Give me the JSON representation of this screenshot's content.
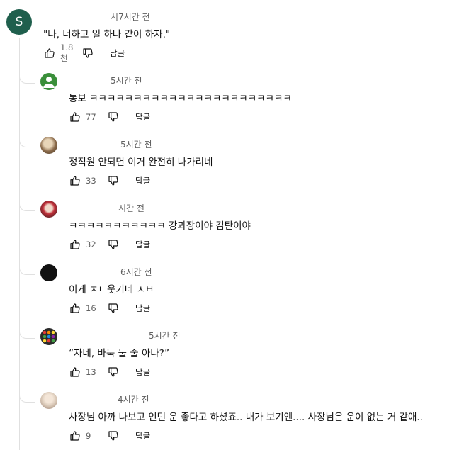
{
  "top_comment": {
    "avatar_letter": "S",
    "time": "시7시간 전",
    "text": "\"나, 너하고 일 하나 같이 하자.\"",
    "likes": "1.8천",
    "reply_label": "답글"
  },
  "replies": [
    {
      "time": "5시간 전",
      "text": "통보 ㅋㅋㅋㅋㅋㅋㅋㅋㅋㅋㅋㅋㅋㅋㅋㅋㅋㅋㅋㅋㅋㅋㅋ",
      "likes": "77",
      "reply_label": "답글",
      "avatar": "default-person-icon",
      "avatar_color": "#3a8f3a"
    },
    {
      "time": "5시간 전",
      "text": "정직원 안되면 이거 완전히 나가리네",
      "likes": "33",
      "reply_label": "답글",
      "avatar": "photo-avatar",
      "avatar_color": "#a88a6a"
    },
    {
      "time": "시간 전",
      "text": "ㅋㅋㅋㅋㅋㅋㅋㅋㅋㅋㅋ 강과장이야 김탄이야",
      "likes": "32",
      "reply_label": "답글",
      "avatar": "photo-avatar",
      "avatar_color": "#c0303a"
    },
    {
      "time": "6시간 전",
      "text": "이게 ㅈㄴ웃기네 ㅅㅂ",
      "likes": "16",
      "reply_label": "답글",
      "avatar": "dark-avatar",
      "avatar_color": "#111111"
    },
    {
      "time": "5시간 전",
      "text": "“자네, 바둑 둘 줄 아나?”",
      "likes": "13",
      "reply_label": "답글",
      "avatar": "rainbow-dots-avatar",
      "avatar_color": "#333333"
    },
    {
      "time": "4시간 전",
      "text": "사장님  아까 나보고 인턴 운 좋다고 하셨죠.. 내가 보기엔.... 사장님은  운이 없는 거 같애..",
      "likes": "9",
      "reply_label": "답글",
      "avatar": "photo-avatar",
      "avatar_color": "#d8c7b6"
    }
  ]
}
